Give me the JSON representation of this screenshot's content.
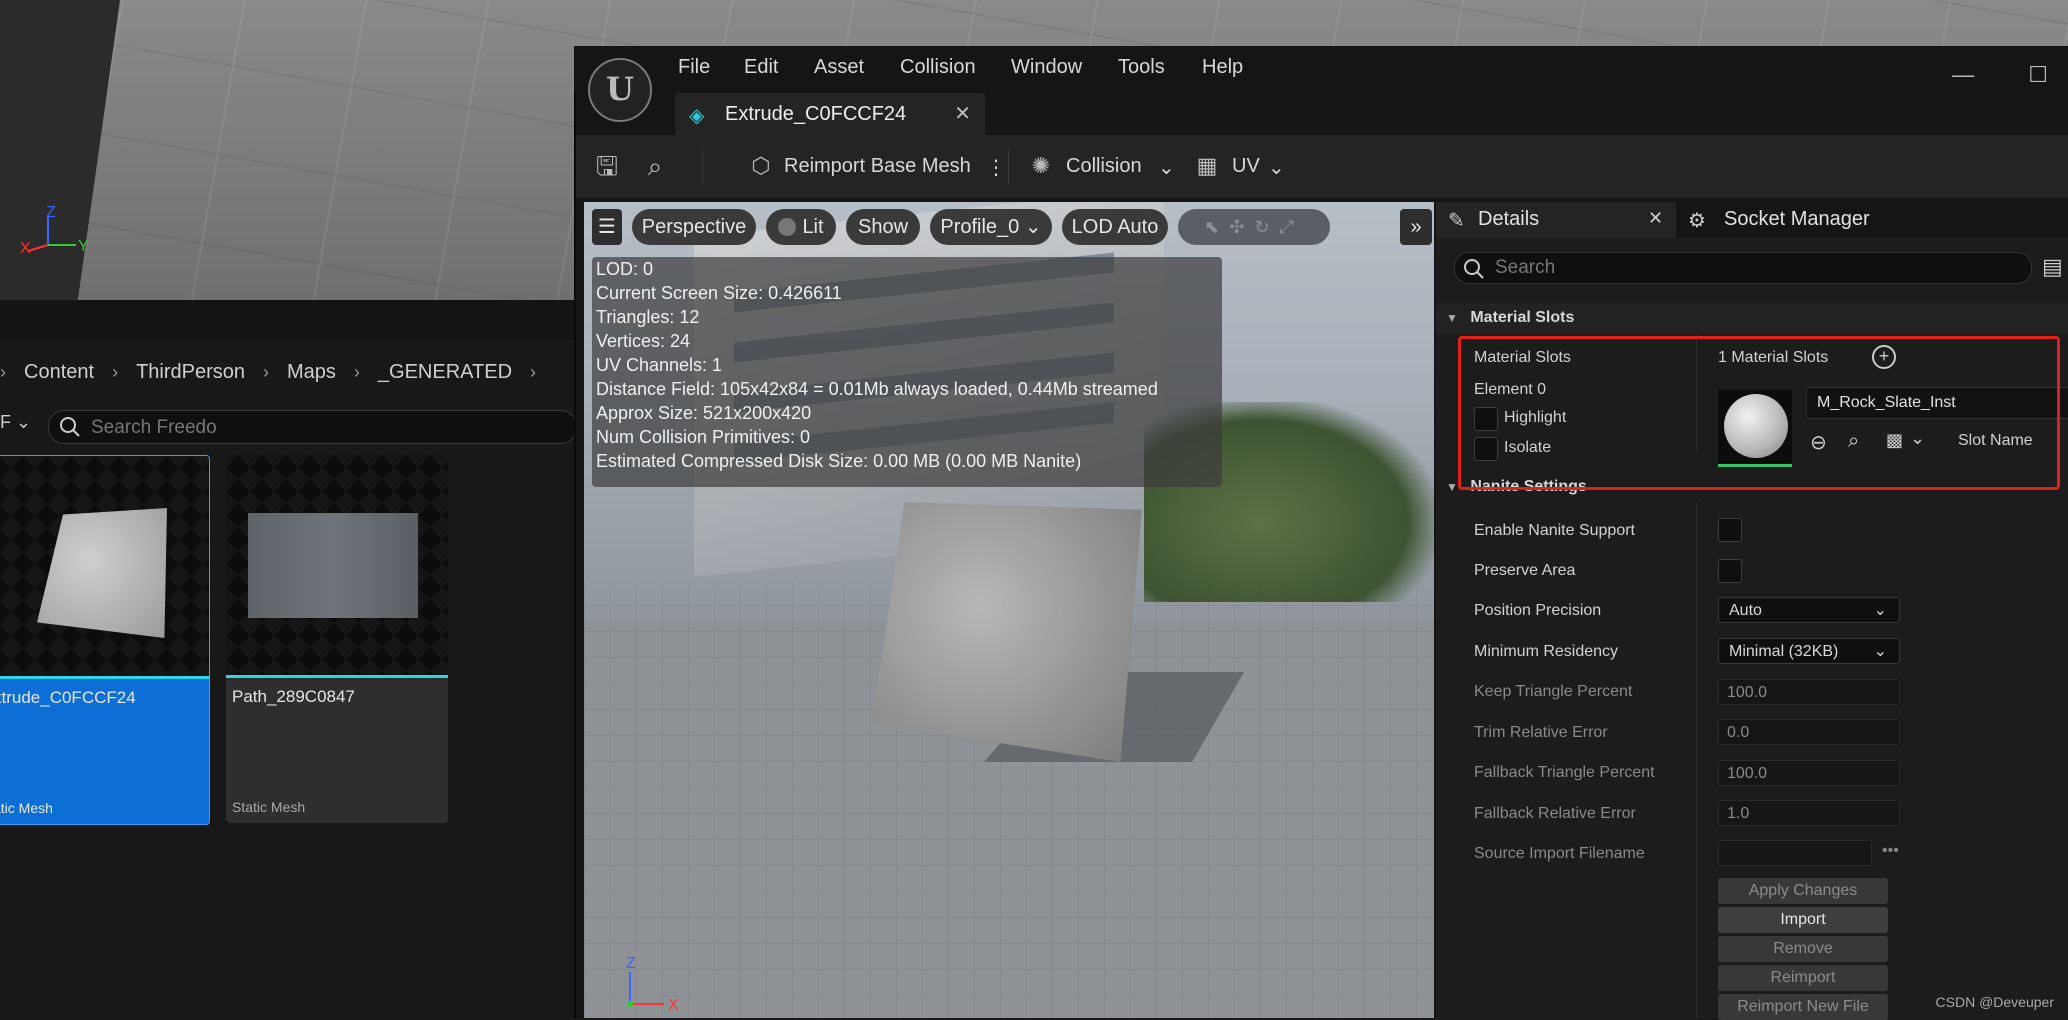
{
  "content_browser": {
    "breadcrumbs": [
      "Content",
      "ThirdPerson",
      "Maps",
      "_GENERATED"
    ],
    "search_placeholder": "Search Freedo",
    "filter_label": "F",
    "assets": [
      {
        "name": "xtrude_C0FCCF24",
        "type": "atic Mesh",
        "selected": true
      },
      {
        "name": "Path_289C0847",
        "type": "Static Mesh",
        "selected": false
      }
    ]
  },
  "editor": {
    "menu": [
      "File",
      "Edit",
      "Asset",
      "Collision",
      "Window",
      "Tools",
      "Help"
    ],
    "tab_title": "Extrude_C0FCCF24",
    "toolbar": {
      "reimport": "Reimport Base Mesh",
      "collision": "Collision",
      "uv": "UV"
    }
  },
  "viewport": {
    "buttons": [
      "Perspective",
      "Lit",
      "Show",
      "Profile_0",
      "LOD Auto"
    ],
    "stats": [
      "LOD:  0",
      "Current Screen Size:  0.426611",
      "Triangles:  12",
      "Vertices:  24",
      "UV Channels:  1",
      "Distance Field:  105x42x84 = 0.01Mb always loaded, 0.44Mb streamed",
      "Approx Size: 521x200x420",
      "Num Collision Primitives:  0",
      "Estimated Compressed Disk Size: 0.00 MB (0.00 MB Nanite)"
    ],
    "axis_z": "Z",
    "axis_x": "X"
  },
  "details": {
    "tab_details": "Details",
    "tab_socket": "Socket Manager",
    "search_placeholder": "Search",
    "material_section": "Material Slots",
    "material_slots_label": "Material Slots",
    "material_slots_count": "1 Material Slots",
    "element_label": "Element 0",
    "highlight": "Highlight",
    "isolate": "Isolate",
    "material_name": "M_Rock_Slate_Inst",
    "slot_name": "Slot Name",
    "nanite_section": "Nanite Settings",
    "rows": [
      {
        "label": "Enable Nanite Support",
        "kind": "check",
        "value": ""
      },
      {
        "label": "Preserve Area",
        "kind": "check",
        "value": ""
      },
      {
        "label": "Position Precision",
        "kind": "combo",
        "value": "Auto"
      },
      {
        "label": "Minimum Residency",
        "kind": "combo",
        "value": "Minimal (32KB)"
      },
      {
        "label": "Keep Triangle Percent",
        "kind": "field",
        "value": "100.0"
      },
      {
        "label": "Trim Relative Error",
        "kind": "field",
        "value": "0.0"
      },
      {
        "label": "Fallback Triangle Percent",
        "kind": "field",
        "value": "100.0"
      },
      {
        "label": "Fallback Relative Error",
        "kind": "field",
        "value": "1.0"
      },
      {
        "label": "Source Import Filename",
        "kind": "file",
        "value": ""
      }
    ],
    "buttons": [
      "Apply Changes",
      "Import",
      "Remove",
      "Reimport",
      "Reimport New File"
    ]
  },
  "watermark": "CSDN @Deveuper"
}
